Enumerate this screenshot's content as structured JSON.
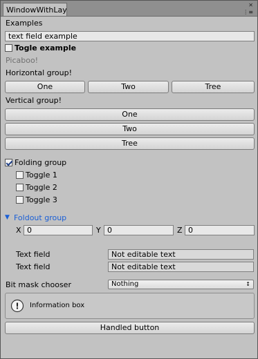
{
  "window": {
    "tab_title": "WindowWithLay",
    "menu_icon": "⋮≡",
    "close_icon": "✕"
  },
  "examples_label": "Examples",
  "text_field_value": "text field example",
  "togle_label": "Togle example",
  "picaboo_label": "Picaboo!",
  "horizontal": {
    "label": "Horizontal group!",
    "buttons": [
      "One",
      "Two",
      "Tree"
    ]
  },
  "vertical": {
    "label": "Vertical group!",
    "buttons": [
      "One",
      "Two",
      "Tree"
    ]
  },
  "folding": {
    "label": "Folding group",
    "checked": true,
    "toggles": [
      "Toggle 1",
      "Toggle 2",
      "Toggle 3"
    ]
  },
  "foldout": {
    "label": "Foldout group",
    "x_label": "X",
    "x_value": "0",
    "y_label": "Y",
    "y_value": "0",
    "z_label": "Z",
    "z_value": "0"
  },
  "readonly_fields": [
    {
      "label": "Text field",
      "value": "Not editable text"
    },
    {
      "label": "Text field",
      "value": "Not editable text"
    }
  ],
  "bitmask": {
    "label": "Bit mask chooser",
    "value": "Nothing",
    "arrow": "↕"
  },
  "info_box": {
    "icon": "!",
    "text": "Information box"
  },
  "handled_button_label": "Handled button",
  "colors": {
    "panel": "#c2c2c2",
    "foldout_blue": "#1a5fd6"
  }
}
